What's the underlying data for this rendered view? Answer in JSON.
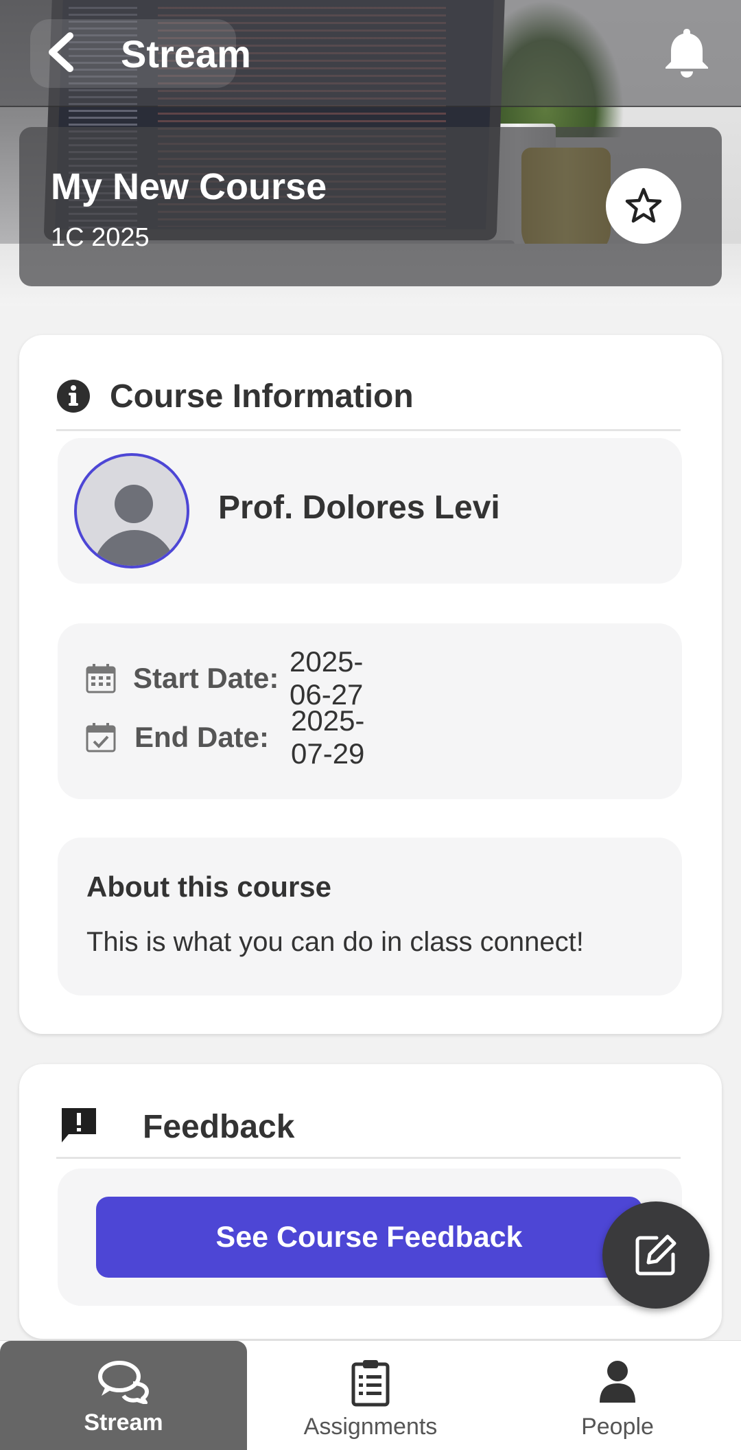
{
  "header": {
    "title": "Stream",
    "back_icon": "chevron-left-icon",
    "notifications_icon": "bell-icon"
  },
  "course": {
    "name": "My New Course",
    "term": "1C 2025",
    "favorite_icon": "star-outline-icon"
  },
  "course_info": {
    "heading": "Course Information",
    "heading_icon": "info-circle-icon",
    "professor": "Prof. Dolores Levi",
    "start_label": "Start Date:",
    "start_value": "2025-06-27",
    "end_label": "End Date:",
    "end_value": "2025-07-29",
    "about_title": "About this course",
    "about_text": "This is what you can do in class connect!"
  },
  "feedback": {
    "heading": "Feedback",
    "heading_icon": "feedback-alert-icon",
    "button_label": "See Course Feedback"
  },
  "fab": {
    "icon": "edit-icon"
  },
  "bottom_nav": {
    "items": [
      {
        "label": "Stream",
        "icon": "chat-bubbles-icon",
        "active": true
      },
      {
        "label": "Assignments",
        "icon": "clipboard-list-icon",
        "active": false
      },
      {
        "label": "People",
        "icon": "person-icon",
        "active": false
      }
    ]
  },
  "colors": {
    "accent": "#4d46d5",
    "active_nav": "#666666",
    "fab": "#3a3a3c"
  }
}
